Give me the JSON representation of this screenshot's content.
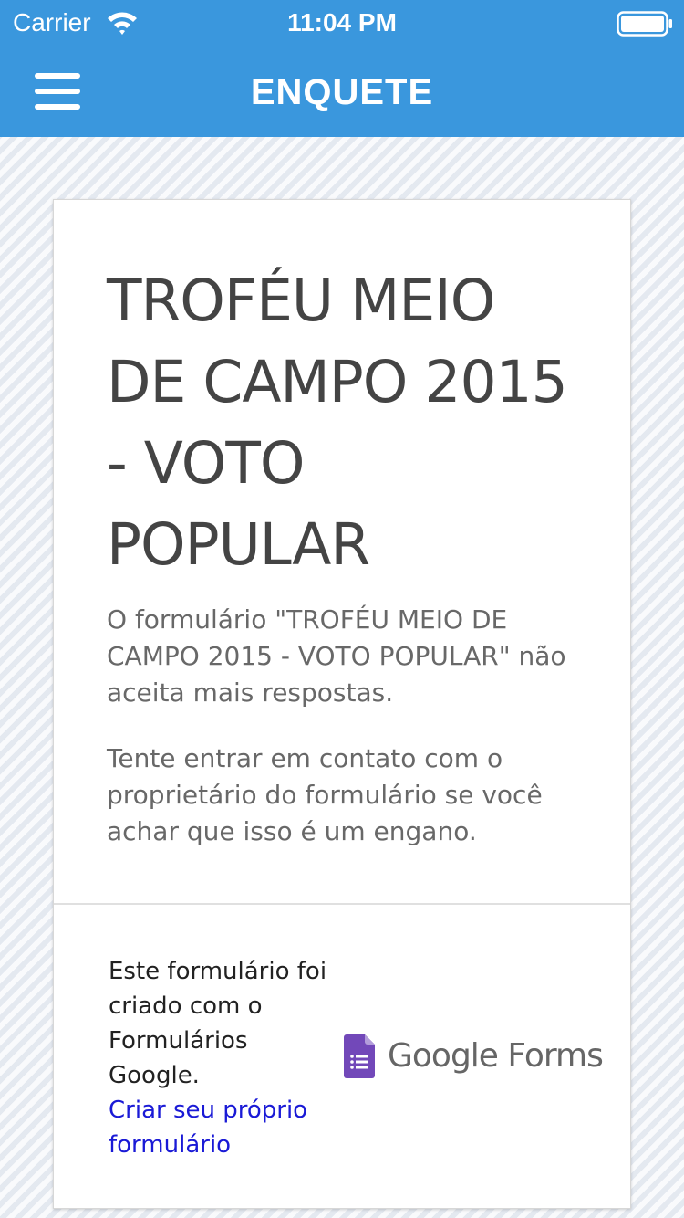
{
  "status_bar": {
    "carrier": "Carrier",
    "time": "11:04 PM",
    "wifi_icon": "wifi-icon",
    "battery_icon": "battery-icon"
  },
  "nav": {
    "title": "ENQUETE",
    "menu_icon": "hamburger-menu-icon"
  },
  "form": {
    "title": "TROFÉU MEIO DE CAMPO 2015 - VOTO POPULAR",
    "closed_message": "O formulário \"TROFÉU MEIO DE CAMPO 2015 - VOTO POPULAR\" não aceita mais respostas.",
    "contact_message": "Tente entrar em contato com o proprietário do formulário se você achar que isso é um engano."
  },
  "footer": {
    "created_with": "Este formulário foi criado com o Formulários Google.",
    "create_link": "Criar seu próprio formulário",
    "brand_google": "Google",
    "brand_forms": "Forms",
    "brand_icon": "google-forms-icon"
  },
  "colors": {
    "header_bg": "#3a97dd",
    "link": "#1a1ad6",
    "forms_purple": "#7248b9"
  }
}
